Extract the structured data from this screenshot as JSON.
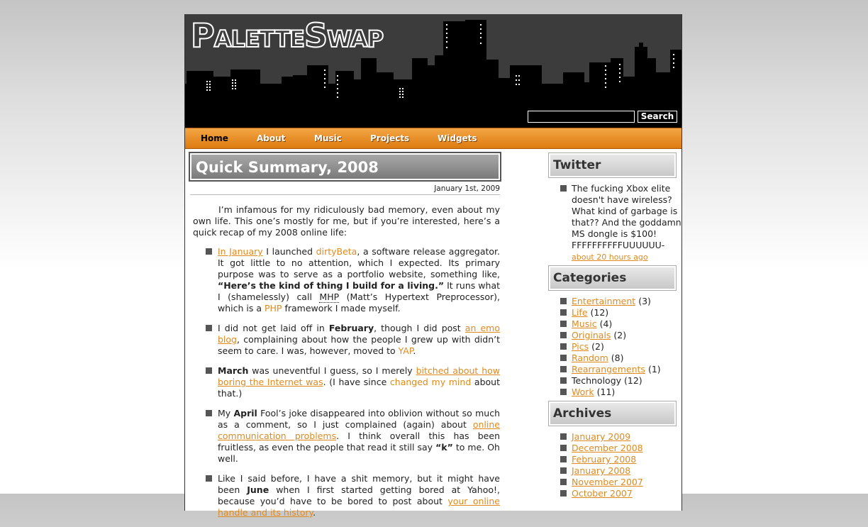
{
  "site": {
    "logo_text": "PaletteSwap",
    "search_button": "Search",
    "search_value": ""
  },
  "nav": [
    {
      "label": "Home"
    },
    {
      "label": "About"
    },
    {
      "label": "Music"
    },
    {
      "label": "Projects"
    },
    {
      "label": "Widgets"
    }
  ],
  "post": {
    "title": "Quick Summary, 2008",
    "date": "January 1st, 2009",
    "intro": "I’m infamous for my ridiculously bad memory, even about my own life. This one’s mostly for me, but if you’re interested, here’s a quick recap of my 2008 online life:",
    "items": [
      {
        "link1": "In January",
        "t1": " I launched ",
        "link2": "dirtyBeta",
        "t2": ", a software release aggregator. It got little to no attention, which I expected. Its primary purpose was to serve as a portfolio website, something like, ",
        "bold": "“Here’s the kind of thing I build for a living.”",
        "t3": " It runs what I (shamelessly) call ",
        "abbr": "MHP",
        "t4": " (Matt’s Hypertext Preprocessor), which is a ",
        "link3": "PHP",
        "t5": " framework I made myself."
      },
      {
        "t1": "I did not get laid off in ",
        "bold": "February",
        "t2": ", though I did post ",
        "link1": "an emo blog",
        "t3": ", complaining about how the people I grew up with didn’t seem to care. I was, however, moved to ",
        "link2": "YAP",
        "t4": "."
      },
      {
        "bold": "March",
        "t1": " was uneventful I guess, so I merely ",
        "link1": "bitched about how boring the Internet was",
        "t2": ". (I have since ",
        "link2": "changed my mind",
        "t3": " about that.)"
      },
      {
        "t1": "My ",
        "bold": "April",
        "t2": " Fool’s joke disappeared into oblivion without so much as a comment, so I just complained (again) about ",
        "link1": "online communication problems",
        "t3": ". I think overall this has been fruitless, as even the people that read it still say ",
        "bold2": "“k”",
        "t4": " to me. Oh well."
      },
      {
        "t1": "Like I said before, I have a shit memory, but it might have been ",
        "bold": "June",
        "t2": " when I first started getting bored at Yahoo!, because you’d have to be bored to post about ",
        "link1": "your online handle and its history",
        "t3": "."
      }
    ]
  },
  "sidebar": {
    "twitter": {
      "heading": "Twitter",
      "tweet": "The fucking Xbox elite doesn't have wireless? What kind of garbage is that?? And the goddamn MS dongle is $100! FFFFFFFFFFUUUUUU-",
      "time": "about 20 hours ago"
    },
    "categories": {
      "heading": "Categories",
      "items": [
        {
          "name": "Entertainment",
          "count": "(3)"
        },
        {
          "name": "Life",
          "count": "(12)"
        },
        {
          "name": "Music",
          "count": "(4)"
        },
        {
          "name": "Originals",
          "count": "(2)"
        },
        {
          "name": "Pics",
          "count": "(2)"
        },
        {
          "name": "Random",
          "count": "(8)"
        },
        {
          "name": "Rearrangements",
          "count": "(1)"
        },
        {
          "name": "Technology",
          "count": "(12)"
        },
        {
          "name": "Work",
          "count": "(11)"
        }
      ]
    },
    "archives": {
      "heading": "Archives",
      "items": [
        "January 2009",
        "December 2008",
        "February 2008",
        "January 2008",
        "November 2007",
        "October 2007"
      ]
    }
  }
}
